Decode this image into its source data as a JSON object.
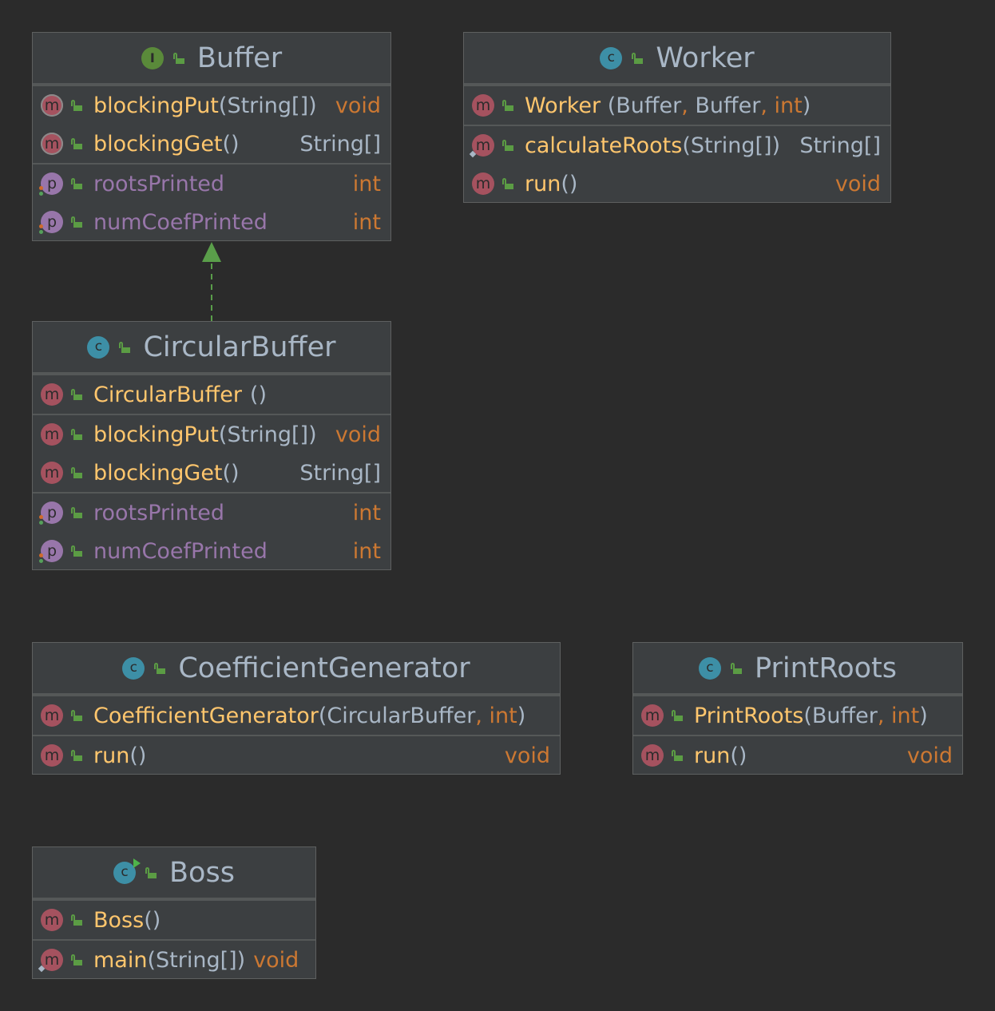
{
  "classes": {
    "buffer": {
      "kind_letter": "I",
      "title": "Buffer",
      "methods": [
        {
          "kind": "m",
          "name": "blockingPut",
          "params_open": "(",
          "params": "String[]",
          "params_close": ")",
          "type": "void"
        },
        {
          "kind": "m",
          "name": "blockingGet",
          "params_open": "()",
          "type": "String[]"
        }
      ],
      "properties": [
        {
          "kind": "p",
          "name": "rootsPrinted",
          "type": "int"
        },
        {
          "kind": "p",
          "name": "numCoefPrinted",
          "type": "int"
        }
      ]
    },
    "worker": {
      "kind_letter": "c",
      "title": "Worker",
      "constructor": {
        "name": "Worker",
        "p1": "(Buffer",
        "sep1": ",",
        "p2": " Buffer",
        "sep2": ",",
        "p3": " int",
        "close": ")"
      },
      "methods": [
        {
          "kind": "m",
          "name": "calculateRoots",
          "params": "(String[])",
          "type": "String[]"
        },
        {
          "kind": "m",
          "name": "run",
          "params": "()",
          "type": "void"
        }
      ]
    },
    "circular_buffer": {
      "kind_letter": "c",
      "title": "CircularBuffer",
      "constructor": {
        "name": "CircularBuffer",
        "params": "()"
      },
      "methods": [
        {
          "kind": "m",
          "name": "blockingPut",
          "params": "(String[])",
          "type": "void"
        },
        {
          "kind": "m",
          "name": "blockingGet",
          "params": "()",
          "type": "String[]"
        }
      ],
      "properties": [
        {
          "kind": "p",
          "name": "rootsPrinted",
          "type": "int"
        },
        {
          "kind": "p",
          "name": "numCoefPrinted",
          "type": "int"
        }
      ]
    },
    "coefficient_generator": {
      "kind_letter": "c",
      "title": "CoefficientGenerator",
      "constructor": {
        "name": "CoefficientGenerator",
        "p1": " (CircularBuffer",
        "sep1": ",",
        "p2": " int",
        "close": ")"
      },
      "methods": [
        {
          "kind": "m",
          "name": "run",
          "params": "()",
          "type": "void"
        }
      ]
    },
    "print_roots": {
      "kind_letter": "c",
      "title": "PrintRoots",
      "constructor": {
        "name": "PrintRoots",
        "p1": " (Buffer",
        "sep1": ",",
        "p2": " int",
        "close": ")"
      },
      "methods": [
        {
          "kind": "m",
          "name": "run",
          "params": "()",
          "type": "void"
        }
      ]
    },
    "boss": {
      "kind_letter": "c",
      "title": "Boss",
      "constructor": {
        "name": "Boss",
        "params": "()"
      },
      "methods": [
        {
          "kind": "m",
          "name": "main",
          "params": "(String[])",
          "type": "void"
        }
      ]
    }
  },
  "relations": [
    {
      "from": "CircularBuffer",
      "to": "Buffer",
      "kind": "implements",
      "style": "dashed",
      "color": "#5a9e4a"
    }
  ],
  "colors": {
    "background": "#2b2b2b",
    "box": "#3c3f41",
    "method_name": "#ffc66d",
    "property_name": "#9876aa",
    "keyword_type": "#cc7832",
    "text": "#a9b7c6"
  }
}
